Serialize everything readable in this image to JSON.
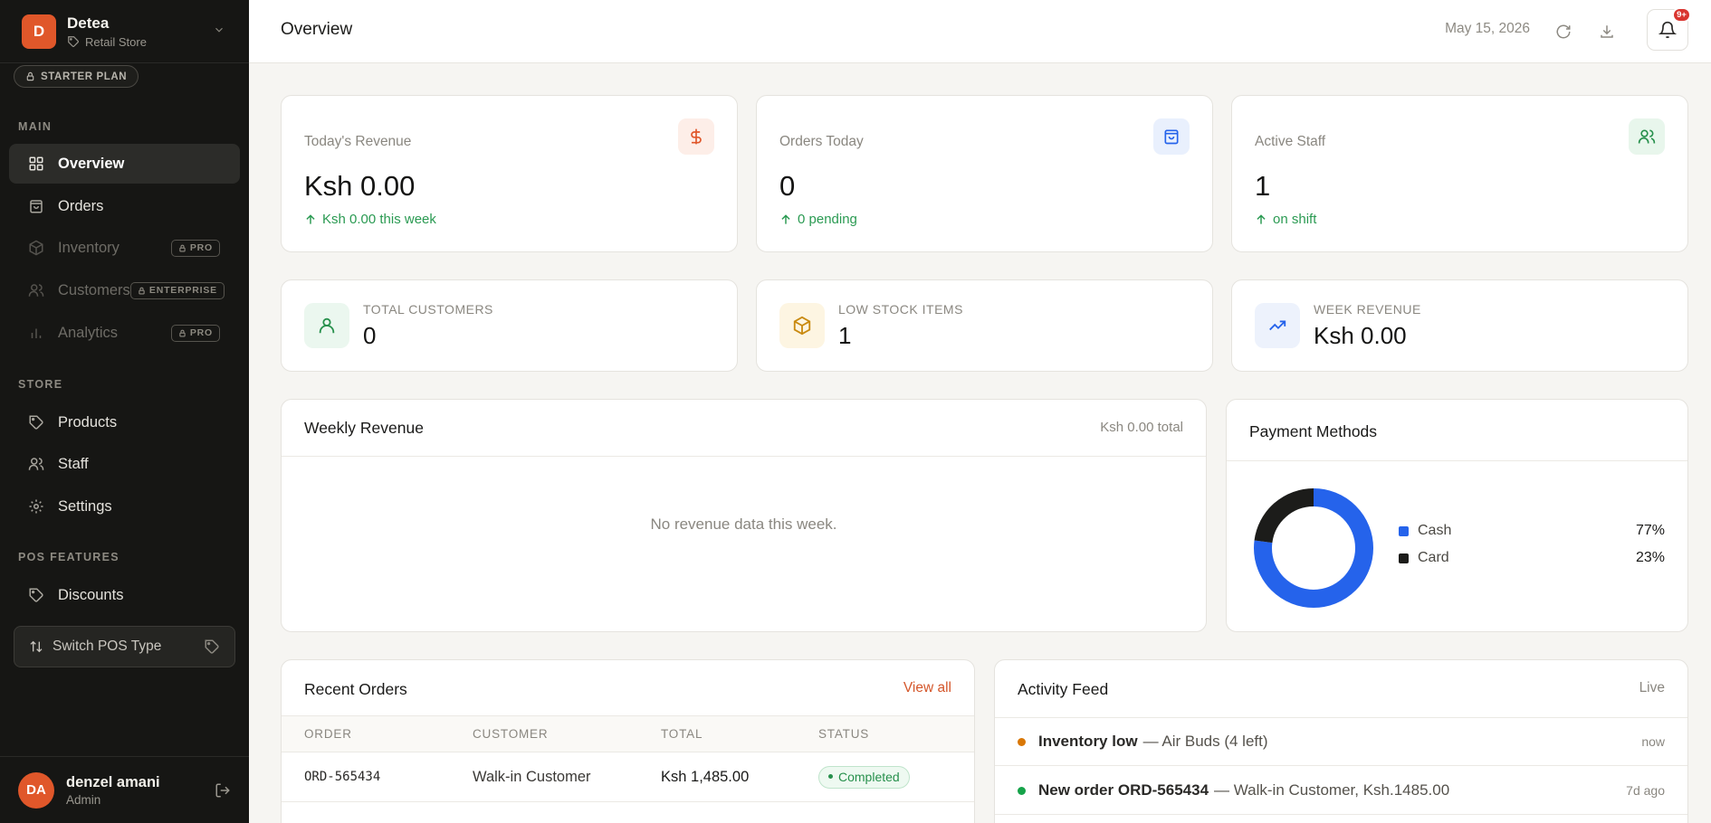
{
  "brand": {
    "initial": "D",
    "name": "Detea",
    "store_type": "Retail Store",
    "plan": "STARTER PLAN"
  },
  "sidebar": {
    "sections": {
      "main": "MAIN",
      "store": "STORE",
      "pos": "POS FEATURES"
    },
    "main_items": [
      {
        "label": "Overview",
        "active": true
      },
      {
        "label": "Orders"
      },
      {
        "label": "Inventory",
        "badge": "PRO"
      },
      {
        "label": "Customers",
        "badge": "ENTERPRISE"
      },
      {
        "label": "Analytics",
        "badge": "PRO"
      }
    ],
    "store_items": [
      {
        "label": "Products"
      },
      {
        "label": "Staff"
      },
      {
        "label": "Settings"
      }
    ],
    "pos_items": [
      {
        "label": "Discounts"
      }
    ],
    "switch_label": "Switch POS Type"
  },
  "user": {
    "initials": "DA",
    "name": "denzel amani",
    "role": "Admin"
  },
  "header": {
    "title": "Overview",
    "date": "May 15, 2026",
    "notif_count": "9+"
  },
  "stats": [
    {
      "label": "Today's Revenue",
      "value": "Ksh 0.00",
      "delta": "Ksh 0.00 this week",
      "icon": "dollar-icon"
    },
    {
      "label": "Orders Today",
      "value": "0",
      "delta": "0 pending",
      "icon": "shopping-bag-icon"
    },
    {
      "label": "Active Staff",
      "value": "1",
      "delta": "on shift",
      "icon": "users-icon"
    }
  ],
  "mini_stats": [
    {
      "label": "TOTAL CUSTOMERS",
      "value": "0",
      "icon": "user-icon"
    },
    {
      "label": "LOW STOCK ITEMS",
      "value": "1",
      "icon": "box-icon"
    },
    {
      "label": "WEEK REVENUE",
      "value": "Ksh 0.00",
      "icon": "trending-up-icon"
    }
  ],
  "weekly_revenue": {
    "title": "Weekly Revenue",
    "total": "Ksh 0.00 total",
    "empty": "No revenue data this week."
  },
  "payment_methods": {
    "title": "Payment Methods",
    "items": [
      {
        "label": "Cash",
        "pct": "77%",
        "value": 77,
        "color": "#2563eb"
      },
      {
        "label": "Card",
        "pct": "23%",
        "value": 23,
        "color": "#1c1c1a"
      }
    ]
  },
  "recent_orders": {
    "title": "Recent Orders",
    "view_all": "View all",
    "columns": [
      "ORDER",
      "CUSTOMER",
      "TOTAL",
      "STATUS"
    ],
    "rows": [
      {
        "order": "ORD-565434",
        "customer": "Walk-in Customer",
        "total": "Ksh 1,485.00",
        "status": "Completed"
      }
    ]
  },
  "activity": {
    "title": "Activity Feed",
    "live": "Live",
    "items": [
      {
        "title": "Inventory low",
        "text": "— Air Buds (4 left)",
        "time": "now",
        "color": "#d97706"
      },
      {
        "title": "New order ORD-565434",
        "text": "— Walk-in Customer, Ksh.1485.00",
        "time": "7d ago",
        "color": "#16a34a"
      }
    ]
  }
}
